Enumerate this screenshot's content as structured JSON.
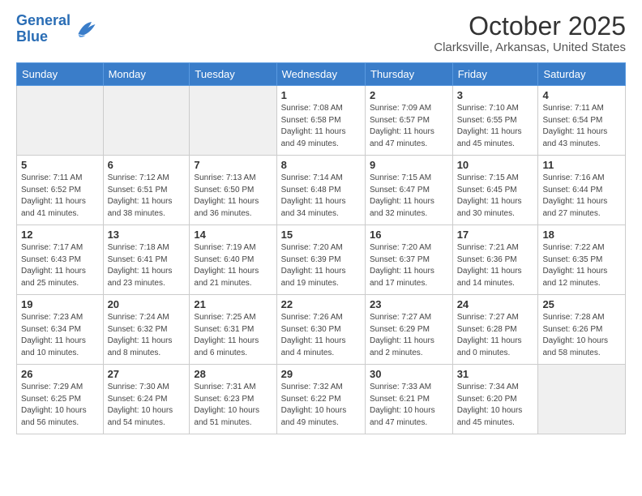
{
  "header": {
    "logo_line1": "General",
    "logo_line2": "Blue",
    "month": "October 2025",
    "location": "Clarksville, Arkansas, United States"
  },
  "weekdays": [
    "Sunday",
    "Monday",
    "Tuesday",
    "Wednesday",
    "Thursday",
    "Friday",
    "Saturday"
  ],
  "weeks": [
    [
      {
        "day": "",
        "info": ""
      },
      {
        "day": "",
        "info": ""
      },
      {
        "day": "",
        "info": ""
      },
      {
        "day": "1",
        "info": "Sunrise: 7:08 AM\nSunset: 6:58 PM\nDaylight: 11 hours\nand 49 minutes."
      },
      {
        "day": "2",
        "info": "Sunrise: 7:09 AM\nSunset: 6:57 PM\nDaylight: 11 hours\nand 47 minutes."
      },
      {
        "day": "3",
        "info": "Sunrise: 7:10 AM\nSunset: 6:55 PM\nDaylight: 11 hours\nand 45 minutes."
      },
      {
        "day": "4",
        "info": "Sunrise: 7:11 AM\nSunset: 6:54 PM\nDaylight: 11 hours\nand 43 minutes."
      }
    ],
    [
      {
        "day": "5",
        "info": "Sunrise: 7:11 AM\nSunset: 6:52 PM\nDaylight: 11 hours\nand 41 minutes."
      },
      {
        "day": "6",
        "info": "Sunrise: 7:12 AM\nSunset: 6:51 PM\nDaylight: 11 hours\nand 38 minutes."
      },
      {
        "day": "7",
        "info": "Sunrise: 7:13 AM\nSunset: 6:50 PM\nDaylight: 11 hours\nand 36 minutes."
      },
      {
        "day": "8",
        "info": "Sunrise: 7:14 AM\nSunset: 6:48 PM\nDaylight: 11 hours\nand 34 minutes."
      },
      {
        "day": "9",
        "info": "Sunrise: 7:15 AM\nSunset: 6:47 PM\nDaylight: 11 hours\nand 32 minutes."
      },
      {
        "day": "10",
        "info": "Sunrise: 7:15 AM\nSunset: 6:45 PM\nDaylight: 11 hours\nand 30 minutes."
      },
      {
        "day": "11",
        "info": "Sunrise: 7:16 AM\nSunset: 6:44 PM\nDaylight: 11 hours\nand 27 minutes."
      }
    ],
    [
      {
        "day": "12",
        "info": "Sunrise: 7:17 AM\nSunset: 6:43 PM\nDaylight: 11 hours\nand 25 minutes."
      },
      {
        "day": "13",
        "info": "Sunrise: 7:18 AM\nSunset: 6:41 PM\nDaylight: 11 hours\nand 23 minutes."
      },
      {
        "day": "14",
        "info": "Sunrise: 7:19 AM\nSunset: 6:40 PM\nDaylight: 11 hours\nand 21 minutes."
      },
      {
        "day": "15",
        "info": "Sunrise: 7:20 AM\nSunset: 6:39 PM\nDaylight: 11 hours\nand 19 minutes."
      },
      {
        "day": "16",
        "info": "Sunrise: 7:20 AM\nSunset: 6:37 PM\nDaylight: 11 hours\nand 17 minutes."
      },
      {
        "day": "17",
        "info": "Sunrise: 7:21 AM\nSunset: 6:36 PM\nDaylight: 11 hours\nand 14 minutes."
      },
      {
        "day": "18",
        "info": "Sunrise: 7:22 AM\nSunset: 6:35 PM\nDaylight: 11 hours\nand 12 minutes."
      }
    ],
    [
      {
        "day": "19",
        "info": "Sunrise: 7:23 AM\nSunset: 6:34 PM\nDaylight: 11 hours\nand 10 minutes."
      },
      {
        "day": "20",
        "info": "Sunrise: 7:24 AM\nSunset: 6:32 PM\nDaylight: 11 hours\nand 8 minutes."
      },
      {
        "day": "21",
        "info": "Sunrise: 7:25 AM\nSunset: 6:31 PM\nDaylight: 11 hours\nand 6 minutes."
      },
      {
        "day": "22",
        "info": "Sunrise: 7:26 AM\nSunset: 6:30 PM\nDaylight: 11 hours\nand 4 minutes."
      },
      {
        "day": "23",
        "info": "Sunrise: 7:27 AM\nSunset: 6:29 PM\nDaylight: 11 hours\nand 2 minutes."
      },
      {
        "day": "24",
        "info": "Sunrise: 7:27 AM\nSunset: 6:28 PM\nDaylight: 11 hours\nand 0 minutes."
      },
      {
        "day": "25",
        "info": "Sunrise: 7:28 AM\nSunset: 6:26 PM\nDaylight: 10 hours\nand 58 minutes."
      }
    ],
    [
      {
        "day": "26",
        "info": "Sunrise: 7:29 AM\nSunset: 6:25 PM\nDaylight: 10 hours\nand 56 minutes."
      },
      {
        "day": "27",
        "info": "Sunrise: 7:30 AM\nSunset: 6:24 PM\nDaylight: 10 hours\nand 54 minutes."
      },
      {
        "day": "28",
        "info": "Sunrise: 7:31 AM\nSunset: 6:23 PM\nDaylight: 10 hours\nand 51 minutes."
      },
      {
        "day": "29",
        "info": "Sunrise: 7:32 AM\nSunset: 6:22 PM\nDaylight: 10 hours\nand 49 minutes."
      },
      {
        "day": "30",
        "info": "Sunrise: 7:33 AM\nSunset: 6:21 PM\nDaylight: 10 hours\nand 47 minutes."
      },
      {
        "day": "31",
        "info": "Sunrise: 7:34 AM\nSunset: 6:20 PM\nDaylight: 10 hours\nand 45 minutes."
      },
      {
        "day": "",
        "info": ""
      }
    ]
  ]
}
